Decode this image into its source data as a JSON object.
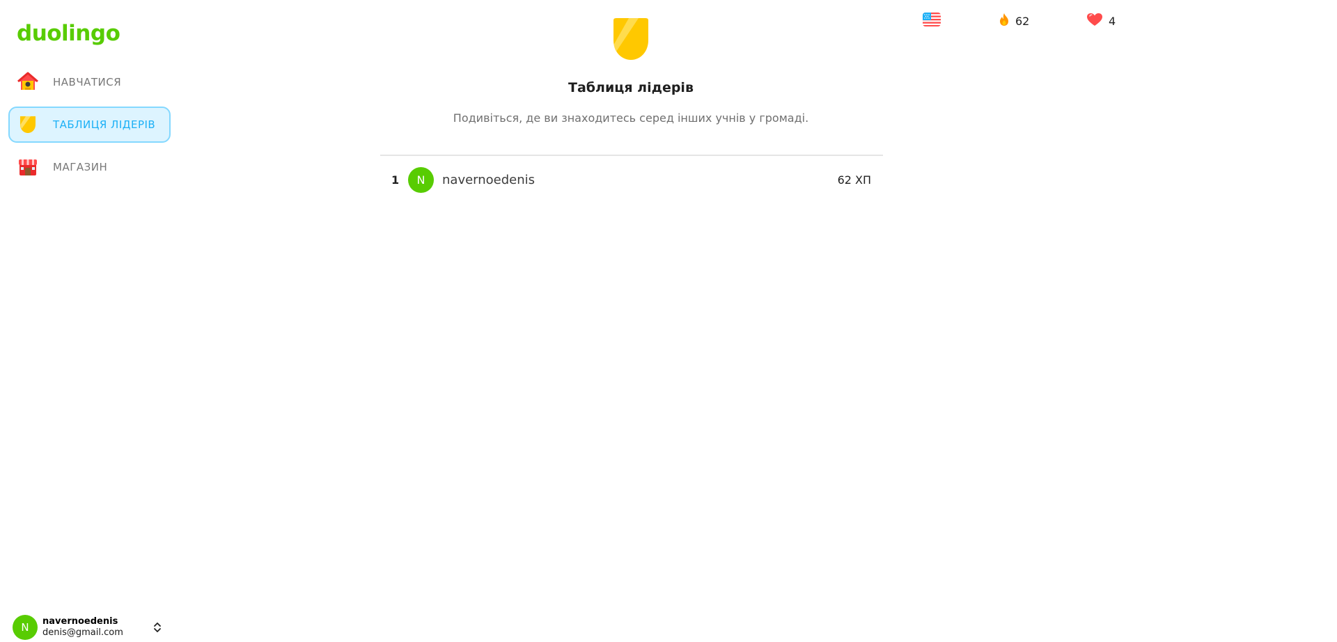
{
  "brand": {
    "name": "duolingo",
    "color": "#58cc02"
  },
  "sidebar": {
    "items": [
      {
        "label": "НАВЧАТИСЯ",
        "icon": "house-icon",
        "active": false
      },
      {
        "label": "ТАБЛИЦЯ ЛІДЕРІВ",
        "icon": "shield-icon",
        "active": true
      },
      {
        "label": "МАГАЗИН",
        "icon": "shop-icon",
        "active": false
      }
    ]
  },
  "user": {
    "initial": "N",
    "name": "navernoedenis",
    "email": "denis@gmail.com"
  },
  "stats": {
    "language_icon": "us-flag-icon",
    "streak": "62",
    "hearts": "4"
  },
  "leaderboard": {
    "title": "Таблиця лідерів",
    "subtitle": "Подивіться, де ви знаходитесь серед інших учнів у громаді.",
    "rows": [
      {
        "rank": "1",
        "initial": "N",
        "name": "navernoedenis",
        "xp": "62 ХП"
      }
    ]
  },
  "colors": {
    "active_bg": "#ddf4ff",
    "active_border": "#84d8ff",
    "active_text": "#1cb0f6",
    "avatar_bg": "#58cc02",
    "shield": "#ffc800"
  }
}
